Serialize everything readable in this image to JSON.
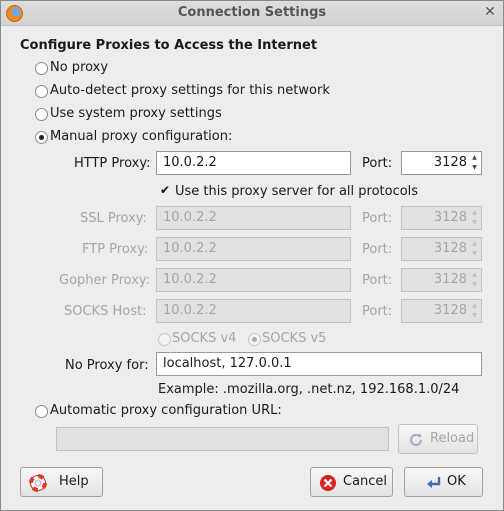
{
  "window": {
    "title": "Connection Settings"
  },
  "heading": "Configure Proxies to Access the Internet",
  "options": {
    "no_proxy": "No proxy",
    "auto_detect": "Auto-detect proxy settings for this network",
    "system": "Use system proxy settings",
    "manual": "Manual proxy configuration:",
    "auto_url": "Automatic proxy configuration URL:"
  },
  "selected_option": "manual",
  "proxies": {
    "http": {
      "label": "HTTP Proxy:",
      "host": "10.0.2.2",
      "port": "3128"
    },
    "ssl": {
      "label": "SSL Proxy:",
      "host": "10.0.2.2",
      "port": "3128"
    },
    "ftp": {
      "label": "FTP Proxy:",
      "host": "10.0.2.2",
      "port": "3128"
    },
    "gopher": {
      "label": "Gopher Proxy:",
      "host": "10.0.2.2",
      "port": "3128"
    },
    "socks": {
      "label": "SOCKS Host:",
      "host": "10.0.2.2",
      "port": "3128"
    }
  },
  "port_label": "Port:",
  "same_proxy_checkbox": {
    "label": "Use this proxy server for all protocols",
    "checked": true
  },
  "socks_version": {
    "v4": "SOCKS v4",
    "v5": "SOCKS v5",
    "selected": "v5"
  },
  "no_proxy_for": {
    "label": "No Proxy for:",
    "value": "localhost, 127.0.0.1"
  },
  "example_text": "Example: .mozilla.org, .net.nz, 192.168.1.0/24",
  "auto_config_url": {
    "value": ""
  },
  "buttons": {
    "reload": "Reload",
    "help": "Help",
    "cancel": "Cancel",
    "ok": "OK"
  },
  "colors": {
    "window_bg": "#ededed",
    "disabled_text": "#a6a6a6",
    "cancel_red": "#d62222",
    "help_red": "#e03a2a"
  }
}
